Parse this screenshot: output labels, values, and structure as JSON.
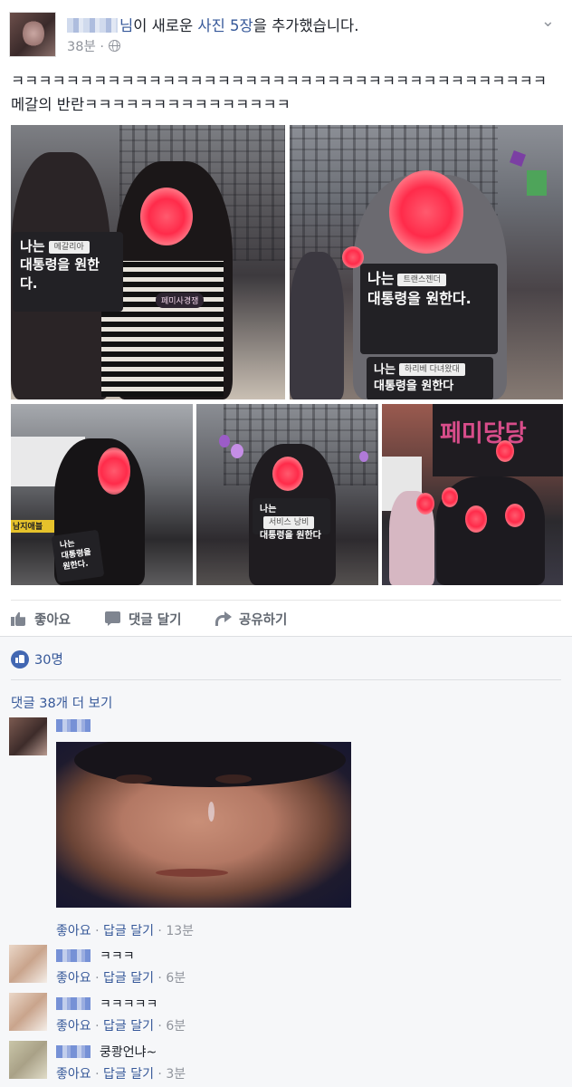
{
  "post": {
    "author_suffix": "님",
    "action_pre": "이 새로운 ",
    "action_link": "사진 5장",
    "action_post": "을 추가했습니다.",
    "time": "38분 ·",
    "text": "ㅋㅋㅋㅋㅋㅋㅋㅋㅋㅋㅋㅋㅋㅋㅋㅋㅋㅋㅋㅋㅋㅋㅋㅋㅋㅋㅋㅋㅋㅋㅋㅋㅋㅋㅋㅋㅋㅋㅋ메갈의 반란ㅋㅋㅋㅋㅋㅋㅋㅋㅋㅋㅋㅋㅋㅋㅋ",
    "more_icon": "chevron-down-icon"
  },
  "photos": {
    "p1": {
      "sign_line1": "나는",
      "sign_mini": "메갈리아",
      "sign_line2": "대통령을 원한다.",
      "badge": "페미사경쟁"
    },
    "p2": {
      "sign_line1": "나는",
      "sign_mini": "트랜스젠더",
      "sign_line2": "대통령을 원한다.",
      "sign2_line1": "나는",
      "sign2_mini": "하리베 다녀왔대",
      "sign2_line2": "대통령을 원한다"
    },
    "p3": {
      "sign_line1": "나는",
      "sign_line2": "대통령을 원한다.",
      "sign_tag": "남지애블"
    },
    "p4": {
      "sign_line1": "나는",
      "sign_mini": "서비스 낭비",
      "sign_line2": "대통령을 원한다"
    },
    "p5": {
      "banner": "페미당당"
    }
  },
  "actions": {
    "like": "좋아요",
    "comment": "댓글 달기",
    "share": "공유하기"
  },
  "reactions": {
    "count": "30명"
  },
  "comments_header": {
    "more": "댓글 38개 더 보기"
  },
  "comments": [
    {
      "text": "",
      "like": "좋아요",
      "reply": "답글 달기",
      "time": "13분"
    },
    {
      "text": "ㅋㅋㅋ",
      "like": "좋아요",
      "reply": "답글 달기",
      "time": "6분"
    },
    {
      "text": "ㅋㅋㅋㅋㅋ",
      "like": "좋아요",
      "reply": "답글 달기",
      "time": "6분"
    },
    {
      "text": "쿵쾅언냐~",
      "like": "좋아요",
      "reply": "답글 달기",
      "time": "3분"
    }
  ],
  "colors": {
    "link": "#365899",
    "meta": "#90949c",
    "like_blue": "#4267b2",
    "comments_bg": "#f6f7f9"
  }
}
